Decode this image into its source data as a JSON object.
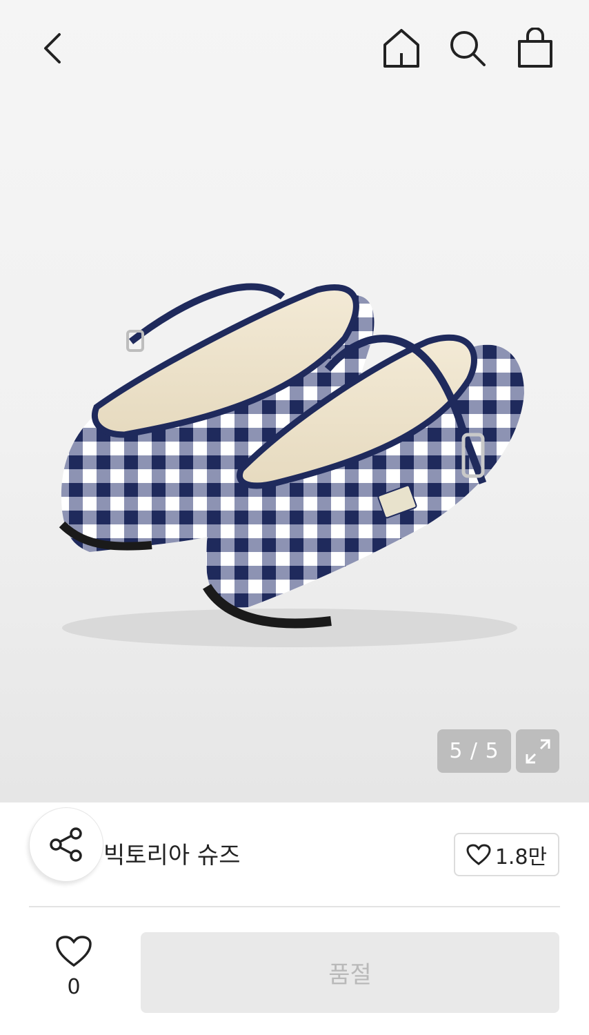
{
  "header": {
    "back_icon": "chevron-left-icon",
    "home_icon": "home-icon",
    "search_icon": "search-icon",
    "bag_icon": "shopping-bag-icon"
  },
  "gallery": {
    "counter": "5 / 5",
    "current": 5,
    "total": 5,
    "expand_icon": "expand-icon",
    "image_description": "navy gingham mary jane flats"
  },
  "product": {
    "name": "빅토리아 슈즈",
    "like_count": "1.8만",
    "share_icon": "share-icon",
    "heart_icon": "heart-icon"
  },
  "bottom_bar": {
    "like_count": "0",
    "action_label": "품절"
  },
  "colors": {
    "navy": "#1f2a5c",
    "button_disabled_bg": "#e9e9e9",
    "button_disabled_text": "#b9b9b9",
    "counter_bg": "#bdbdbd"
  }
}
